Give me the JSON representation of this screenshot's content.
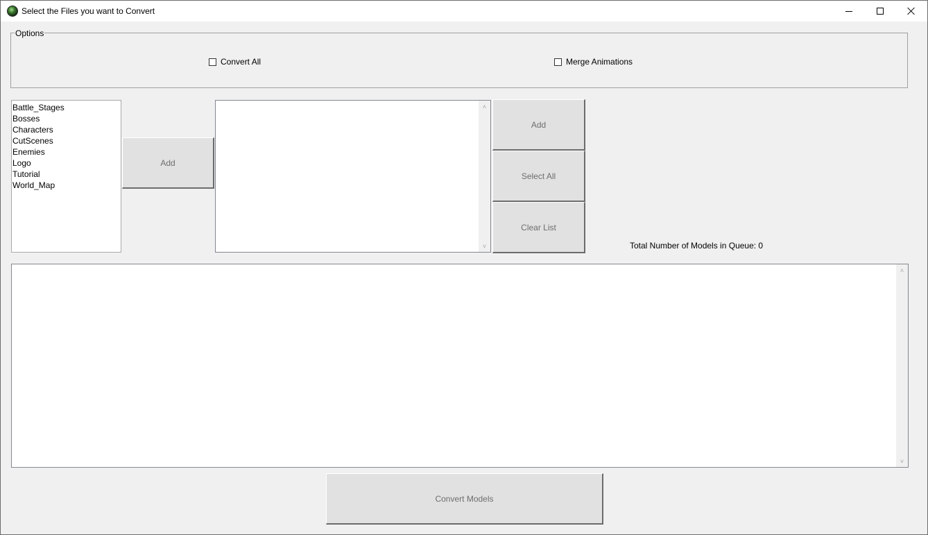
{
  "window": {
    "title": "Select the Files you want to Convert",
    "icon": "green-orb-icon"
  },
  "options": {
    "legend": "Options",
    "convert_all": {
      "label": "Convert All",
      "checked": false
    },
    "merge_animations": {
      "label": "Merge Animations",
      "checked": false
    }
  },
  "folders": {
    "items": [
      "Battle_Stages",
      "Bosses",
      "Characters",
      "CutScenes",
      "Enemies",
      "Logo",
      "Tutorial",
      "World_Map"
    ]
  },
  "buttons": {
    "add_left": "Add",
    "add_right": "Add",
    "select_all": "Select All",
    "clear_list": "Clear List",
    "convert_models": "Convert Models"
  },
  "queue": {
    "count_label": "Total Number of Models in Queue: 0",
    "items": []
  },
  "log": {
    "text": ""
  }
}
